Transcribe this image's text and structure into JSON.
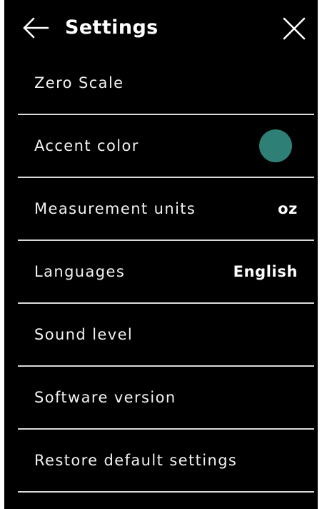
{
  "header": {
    "title": "Settings",
    "back_icon": "arrow-left-icon",
    "close_icon": "close-icon"
  },
  "settings": {
    "zero_scale": {
      "label": "Zero Scale"
    },
    "accent_color": {
      "label": "Accent color",
      "swatch_color": "#2E8077"
    },
    "measurement_units": {
      "label": "Measurement units",
      "value": "oz"
    },
    "languages": {
      "label": "Languages",
      "value": "English"
    },
    "sound_level": {
      "label": "Sound level"
    },
    "software_version": {
      "label": "Software version"
    },
    "restore_defaults": {
      "label": "Restore default settings"
    }
  },
  "colors": {
    "background": "#000000",
    "text": "#FFFFFF",
    "divider": "#D9D9D9",
    "accent": "#2E8077"
  }
}
